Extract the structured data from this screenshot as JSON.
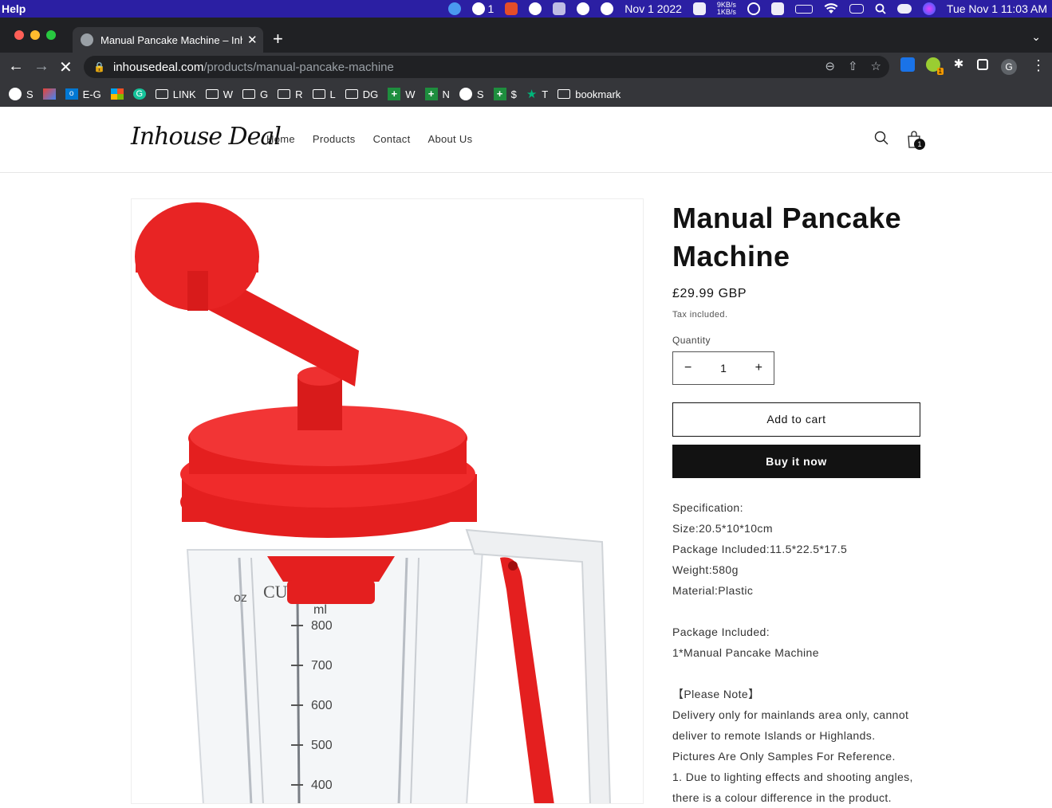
{
  "macos": {
    "menu_item": "Help",
    "wechat_count": "1",
    "date_short": "Nov 1 2022",
    "net_up": "9KB/s",
    "net_down": "1KB/s",
    "clock": "Tue Nov 1  11:03 AM"
  },
  "browser": {
    "tab_title": "Manual Pancake Machine – Inhouse Deal",
    "url_host": "inhousedeal.com",
    "url_path": "/products/manual-pancake-machine",
    "profile_initial": "G",
    "extension_badge": "1",
    "bookmarks": [
      "S",
      "E-G",
      "LINK",
      "W",
      "G",
      "R",
      "L",
      "DG",
      "W",
      "N",
      "S",
      "$",
      "T",
      "bookmark"
    ]
  },
  "site": {
    "logo": "Inhouse Deal",
    "nav": [
      "Home",
      "Products",
      "Contact",
      "About Us"
    ],
    "cart_count": "1"
  },
  "product": {
    "title": "Manual Pancake Machine",
    "price": "£29.99 GBP",
    "tax_note": "Tax included.",
    "quantity_label": "Quantity",
    "quantity": "1",
    "decrease": "−",
    "increase": "+",
    "add_to_cart": "Add to cart",
    "buy_now": "Buy it now",
    "description": [
      "Specification:",
      "Size:20.5*10*10cm",
      "Package Included:11.5*22.5*17.5",
      "Weight:580g",
      "Material:Plastic",
      "",
      "Package Included:",
      "1*Manual Pancake Machine",
      "",
      "【Please Note】",
      "Delivery only for mainlands area only, cannot deliver to remote Islands or Highlands.",
      "Pictures Are Only Samples For Reference.",
      "1. Due to lighting effects and shooting angles, there is a colour difference in the product."
    ],
    "image_scale": [
      "oz",
      "CUP",
      "ml",
      "800",
      "700",
      "600",
      "500",
      "400"
    ]
  }
}
